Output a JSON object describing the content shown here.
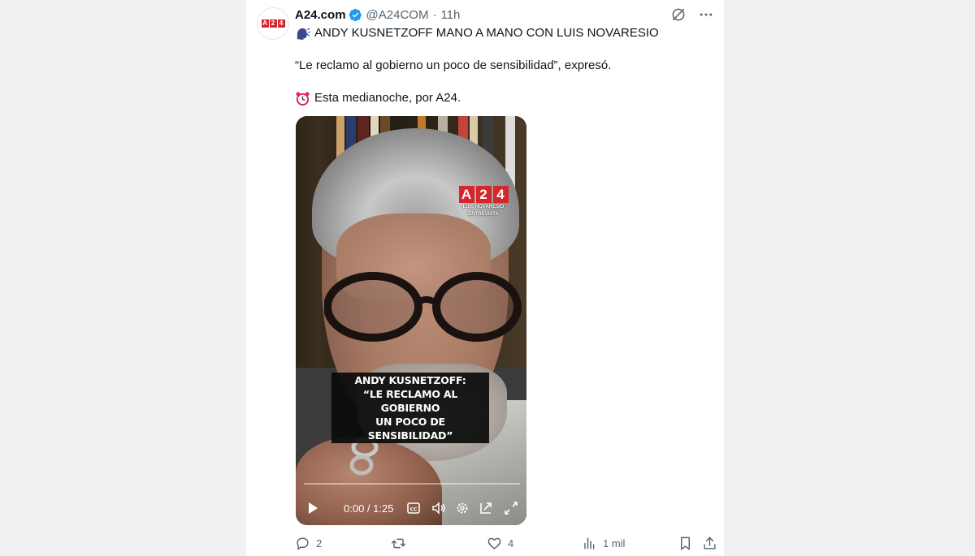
{
  "tweet": {
    "author_name": "A24.com",
    "handle": "@A24COM",
    "separator": "·",
    "time": "11h",
    "avatar_letters": [
      "A",
      "2",
      "4"
    ],
    "text_line1": "ANDY KUSNETZOFF MANO A MANO CON LUIS NOVARESIO",
    "text_line2": "“Le reclamo al gobierno un poco de sensibilidad”, expresó.",
    "text_line3": "Esta medianoche, por A24.",
    "icons": {
      "line1": "speaking-head-icon",
      "line3": "alarm-clock-icon"
    }
  },
  "video": {
    "logo_letters": [
      "A",
      "2",
      "4"
    ],
    "logo_sub1": "LUIS NOVARESIO",
    "logo_sub2": "ENTREVISTA",
    "caption_line1": "ANDY KUSNETZOFF:",
    "caption_line2": "“LE RECLAMO AL GOBIERNO",
    "caption_line3": "UN POCO DE SENSIBILIDAD”",
    "time_display": "0:00 / 1:25",
    "progress": 0
  },
  "actions": {
    "replies": "2",
    "retweets": "",
    "likes": "4",
    "views": "1 mil"
  },
  "colors": {
    "accent": "#1d9bf0",
    "brand_red": "#d7262b",
    "secondary_text": "#536471"
  }
}
